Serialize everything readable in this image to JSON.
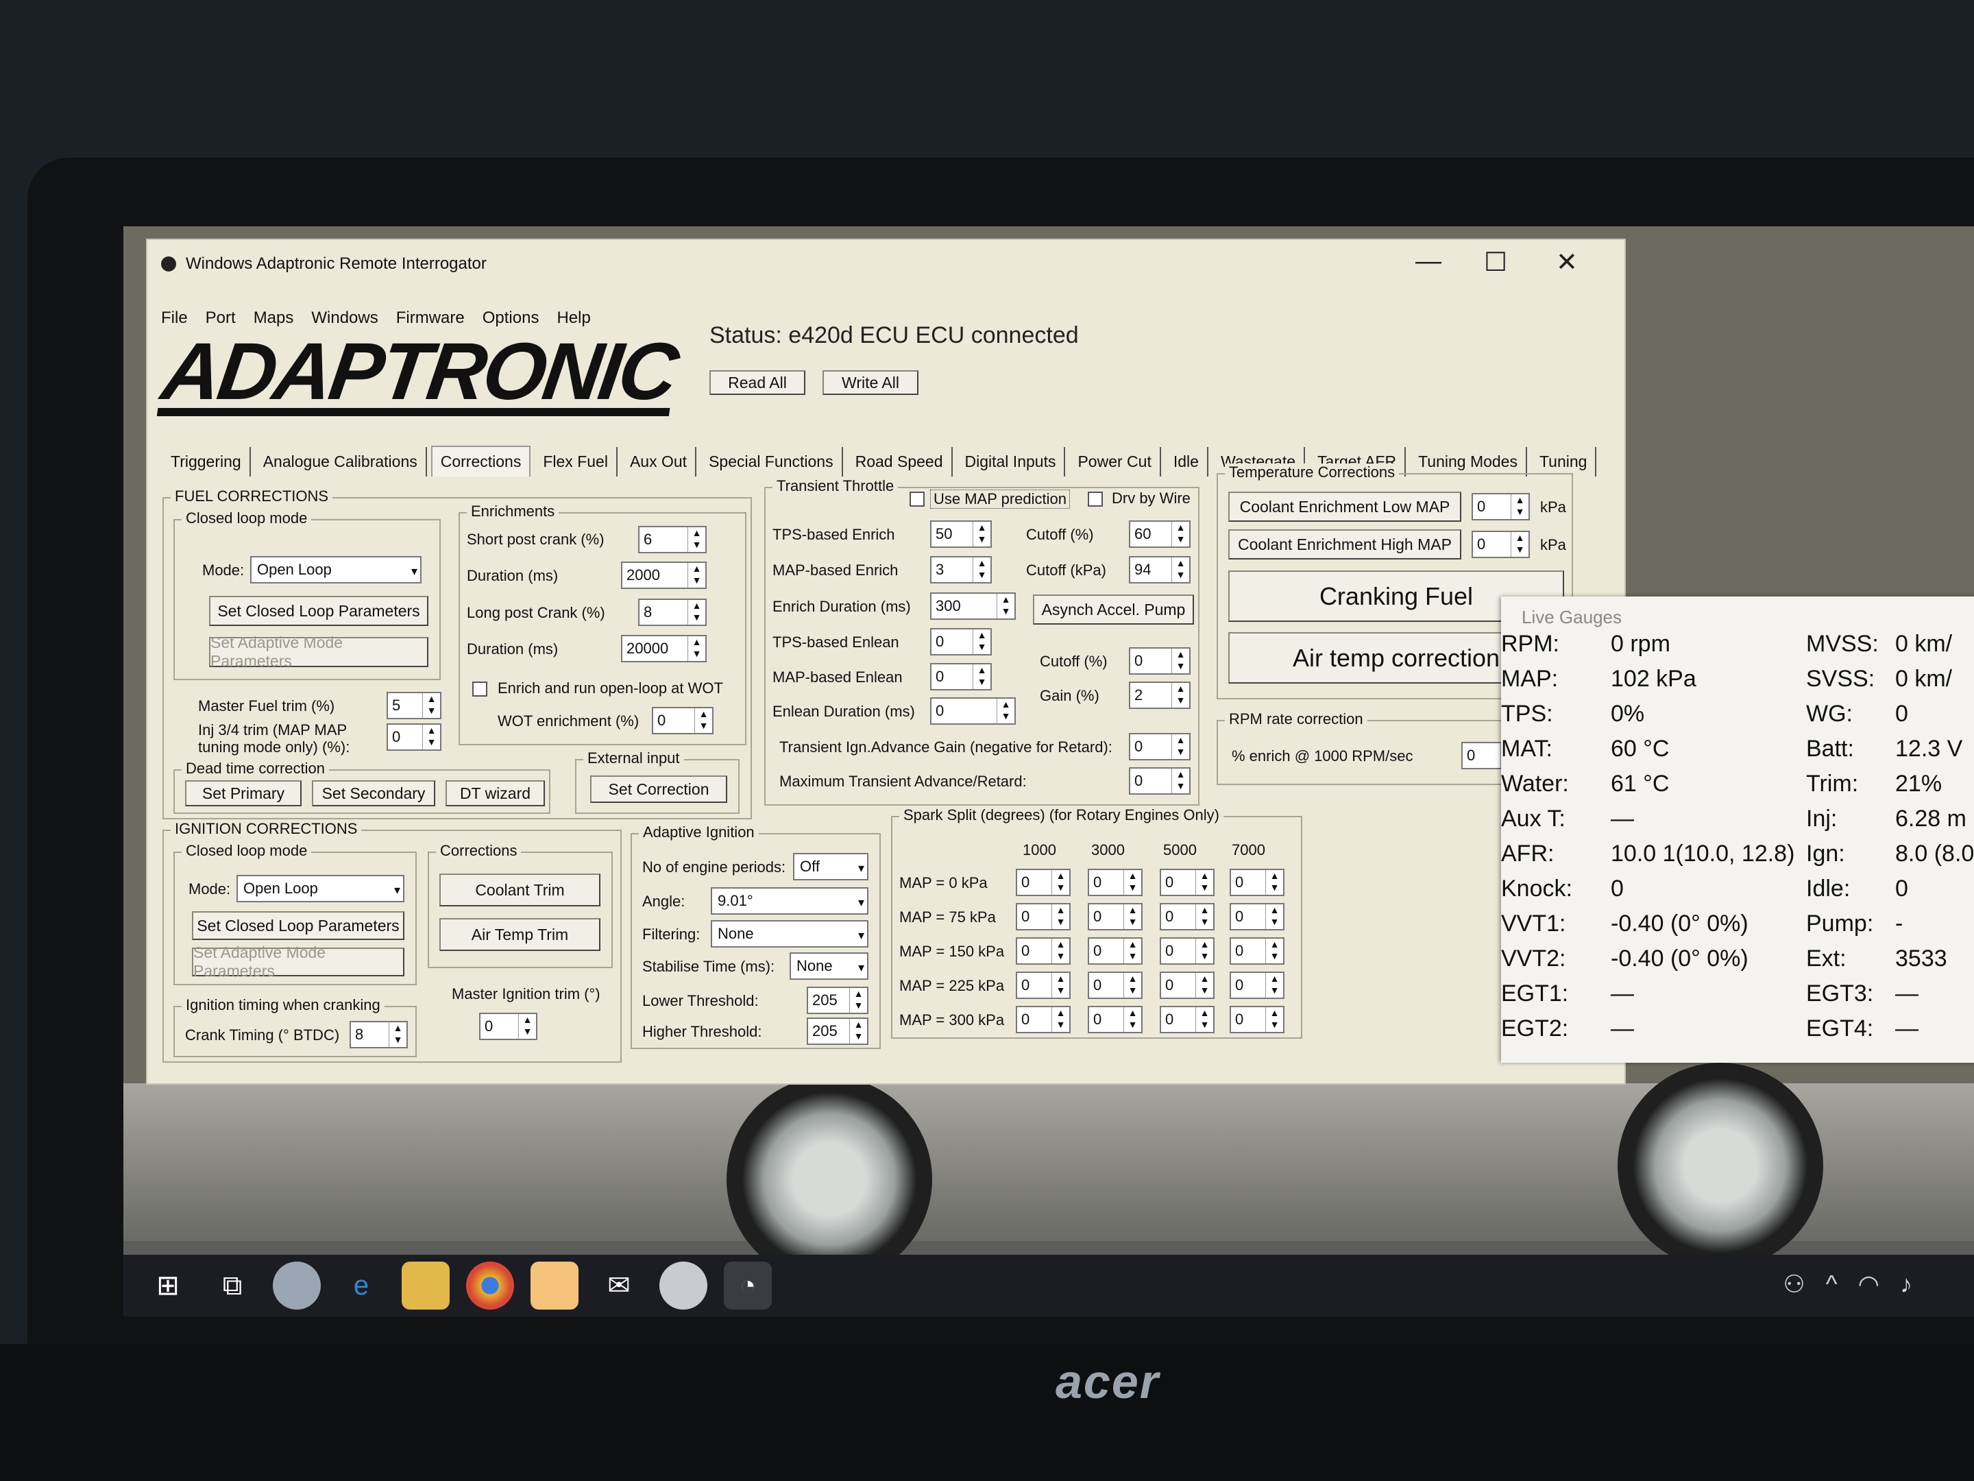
{
  "window": {
    "title": "Windows Adaptronic Remote Interrogator",
    "minimize": "—",
    "maximize": "☐",
    "close": "✕"
  },
  "menu": [
    "File",
    "Port",
    "Maps",
    "Windows",
    "Firmware",
    "Options",
    "Help"
  ],
  "logo": "ADAPTRONIC",
  "status": "Status:   e420d ECU ECU connected",
  "buttons": {
    "read_all": "Read All",
    "write_all": "Write All"
  },
  "tabs_top": [
    "Idle",
    "Wastegate",
    "Target AFR",
    "Tuning Modes",
    "Tuning"
  ],
  "tabs_bottom": [
    "Triggering",
    "Analogue Calibrations",
    "Corrections",
    "Flex Fuel",
    "Aux Out",
    "Special Functions",
    "Road Speed",
    "Digital Inputs",
    "Power Cut"
  ],
  "fuel": {
    "title": "FUEL CORRECTIONS",
    "closed_loop": {
      "title": "Closed loop mode",
      "mode_label": "Mode:",
      "mode": "Open Loop",
      "set_params": "Set Closed Loop Parameters",
      "set_adaptive": "Set Adaptive Mode Parameters"
    },
    "master_trim_label": "Master Fuel trim (%)",
    "master_trim": "5",
    "inj34_label1": "Inj 3/4 trim (MAP MAP",
    "inj34_label2": "tuning mode only) (%):",
    "inj34": "0",
    "dead_time": {
      "title": "Dead time correction",
      "primary": "Set Primary",
      "secondary": "Set Secondary",
      "wizard": "DT wizard"
    },
    "external": {
      "title": "External input",
      "button": "Set Correction"
    },
    "enrich": {
      "title": "Enrichments",
      "short_post_label": "Short post crank (%)",
      "short_post": "6",
      "duration1_label": "Duration (ms)",
      "duration1": "2000",
      "long_post_label": "Long post Crank (%)",
      "long_post": "8",
      "duration2_label": "Duration (ms)",
      "duration2": "20000",
      "wot_check": "Enrich and run open-loop at WOT",
      "wot_label": "WOT enrichment (%)",
      "wot": "0"
    }
  },
  "transient": {
    "title": "Transient Throttle",
    "use_map": "Use MAP prediction",
    "dbw": "Drv by Wire",
    "tps_enrich_label": "TPS-based Enrich",
    "tps_enrich": "50",
    "map_enrich_label": "MAP-based Enrich",
    "map_enrich": "3",
    "enrich_dur_label": "Enrich Duration (ms)",
    "enrich_dur": "300",
    "tps_enlean_label": "TPS-based Enlean",
    "tps_enlean": "0",
    "map_enlean_label": "MAP-based Enlean",
    "map_enlean": "0",
    "enlean_dur_label": "Enlean Duration (ms)",
    "enlean_dur": "0",
    "cutoff_pct_label": "Cutoff (%)",
    "cutoff_pct": "60",
    "cutoff_kpa_label": "Cutoff (kPa)",
    "cutoff_kpa": "94",
    "asynch": "Asynch Accel. Pump",
    "cutoff2_label": "Cutoff (%)",
    "cutoff2": "0",
    "gain_label": "Gain (%)",
    "gain": "2",
    "ign_gain_label": "Transient Ign.Advance Gain (negative for Retard):",
    "ign_gain": "0",
    "max_adv_label": "Maximum Transient Advance/Retard:",
    "max_adv": "0"
  },
  "temp": {
    "title": "Temperature Corrections",
    "low_map": "Coolant Enrichment Low MAP",
    "low_val": "0",
    "high_map": "Coolant Enrichment High MAP",
    "high_val": "0",
    "unit": "kPa",
    "cranking": "Cranking Fuel",
    "air_temp": "Air temp correction"
  },
  "rpm_rate": {
    "title": "RPM rate correction",
    "label": "% enrich @ 1000 RPM/sec",
    "value": "0"
  },
  "ign": {
    "title": "IGNITION CORRECTIONS",
    "closed_loop_title": "Closed loop mode",
    "mode_label": "Mode:",
    "mode": "Open Loop",
    "set_params": "Set Closed Loop Parameters",
    "set_adaptive": "Set Adaptive Mode Parameters",
    "crank_title": "Ignition timing when cranking",
    "crank_label": "Crank Timing (° BTDC)",
    "crank": "8",
    "corrections_title": "Corrections",
    "coolant": "Coolant Trim",
    "air_temp": "Air Temp Trim",
    "master_label": "Master Ignition trim (°)",
    "master": "0"
  },
  "adaptive": {
    "title": "Adaptive Ignition",
    "periods_label": "No of engine periods:",
    "periods": "Off",
    "angle_label": "Angle:",
    "angle": "9.01°",
    "filter_label": "Filtering:",
    "filter": "None",
    "stab_label": "Stabilise Time (ms):",
    "stab": "None",
    "lower_label": "Lower Threshold:",
    "lower": "205",
    "higher_label": "Higher Threshold:",
    "higher": "205"
  },
  "spark": {
    "title": "Spark Split (degrees) (for Rotary Engines Only)",
    "rpm": [
      "1000",
      "3000",
      "5000",
      "7000"
    ],
    "rows": [
      {
        "label": "MAP = 0 kPa",
        "v": [
          "0",
          "0",
          "0",
          "0"
        ]
      },
      {
        "label": "MAP =  75 kPa",
        "v": [
          "0",
          "0",
          "0",
          "0"
        ]
      },
      {
        "label": "MAP = 150 kPa",
        "v": [
          "0",
          "0",
          "0",
          "0"
        ]
      },
      {
        "label": "MAP = 225 kPa",
        "v": [
          "0",
          "0",
          "0",
          "0"
        ]
      },
      {
        "label": "MAP = 300 kPa",
        "v": [
          "0",
          "0",
          "0",
          "0"
        ]
      }
    ]
  },
  "gauges": {
    "title": "Live Gauges",
    "left": [
      {
        "k": "RPM:",
        "v": "0 rpm"
      },
      {
        "k": "MAP:",
        "v": "102 kPa"
      },
      {
        "k": "TPS:",
        "v": "0%"
      },
      {
        "k": "MAT:",
        "v": "60 °C"
      },
      {
        "k": "Water:",
        "v": "61 °C"
      },
      {
        "k": "Aux T:",
        "v": "—"
      },
      {
        "k": "AFR:",
        "v": "10.0 1(10.0, 12.8)"
      },
      {
        "k": "Knock:",
        "v": "0"
      },
      {
        "k": "VVT1:",
        "v": "-0.40 (0° 0%)"
      },
      {
        "k": "VVT2:",
        "v": "-0.40 (0° 0%)"
      },
      {
        "k": "EGT1:",
        "v": "—"
      },
      {
        "k": "EGT2:",
        "v": "—"
      }
    ],
    "right": [
      {
        "k": "MVSS:",
        "v": "0 km/"
      },
      {
        "k": "SVSS:",
        "v": "0 km/"
      },
      {
        "k": "WG:",
        "v": "0"
      },
      {
        "k": "Batt:",
        "v": "12.3 V"
      },
      {
        "k": "Trim:",
        "v": "21%"
      },
      {
        "k": "Inj:",
        "v": "6.28 m"
      },
      {
        "k": "Ign:",
        "v": "8.0 (8.0"
      },
      {
        "k": "Idle:",
        "v": "0"
      },
      {
        "k": "Pump:",
        "v": "-"
      },
      {
        "k": "Ext:",
        "v": "3533"
      },
      {
        "k": "EGT3:",
        "v": "—"
      },
      {
        "k": "EGT4:",
        "v": "—"
      }
    ]
  },
  "laptop_brand": "acer"
}
